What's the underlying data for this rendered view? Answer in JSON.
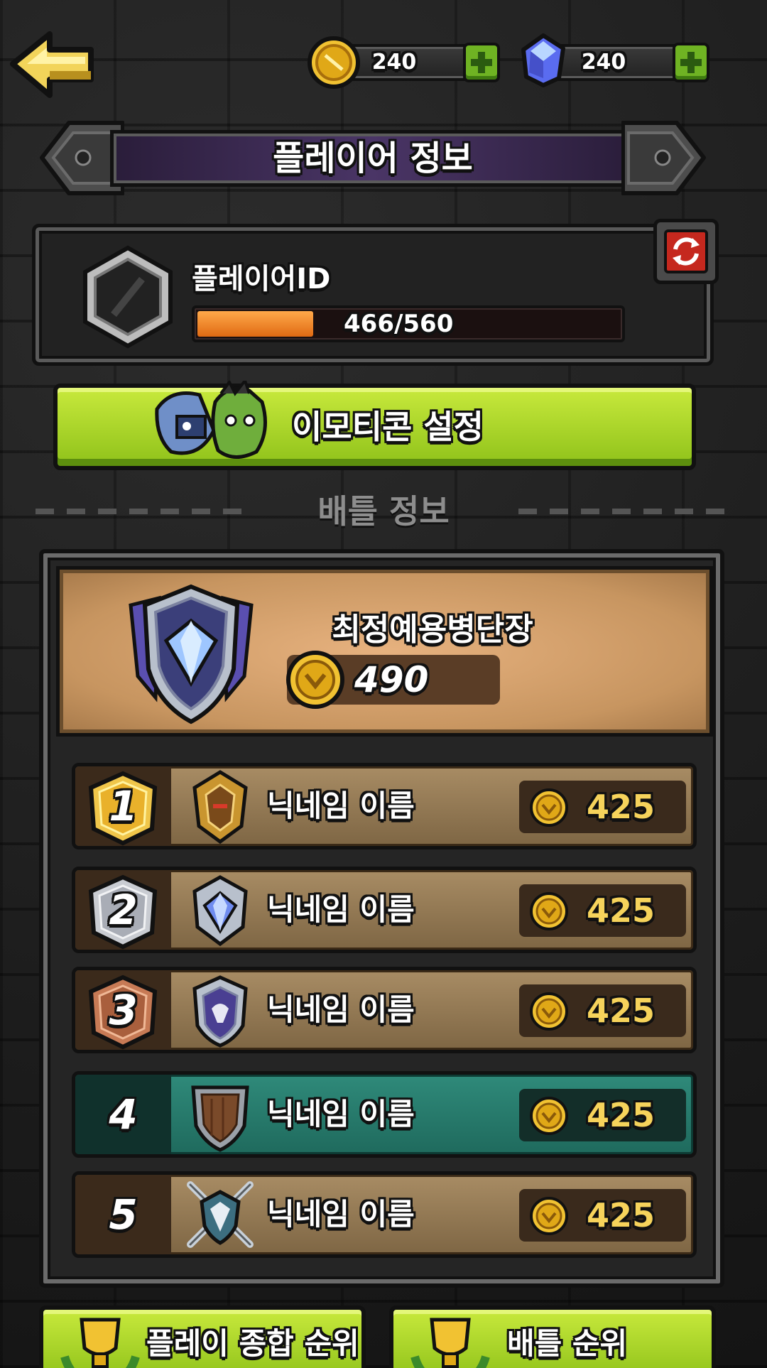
{
  "header": {
    "gold_amount": "240",
    "gem_amount": "240",
    "title": "플레이어 정보"
  },
  "player": {
    "name": "플레이어ID",
    "xp_text": "466/560",
    "xp_current": 466,
    "xp_max": 560
  },
  "emoticon_button": {
    "label": "이모티콘 설정"
  },
  "battle": {
    "section_title": "배틀 정보",
    "tier_name": "최정예용병단장",
    "tier_score": "490",
    "ranking": [
      {
        "rank": "1",
        "name": "닉네임 이름",
        "score": "425",
        "badge": "gold-rank-badge",
        "emblem": "gold-helmet-emblem"
      },
      {
        "rank": "2",
        "name": "닉네임 이름",
        "score": "425",
        "badge": "silver-rank-badge",
        "emblem": "diamond-emblem"
      },
      {
        "rank": "3",
        "name": "닉네임 이름",
        "score": "425",
        "badge": "bronze-rank-badge",
        "emblem": "eagle-shield-emblem"
      },
      {
        "rank": "4",
        "name": "닉네임 이름",
        "score": "425",
        "badge": "none",
        "emblem": "wood-shield-emblem"
      },
      {
        "rank": "5",
        "name": "닉네임 이름",
        "score": "425",
        "badge": "none",
        "emblem": "crossed-swords-emblem"
      }
    ]
  },
  "bottom_nav": {
    "overall_ranking_label": "플레이 종합 순위",
    "battle_ranking_label": "배틀 순위"
  },
  "colors": {
    "accent_green": "#9fd326",
    "highlight_row": "#2f8a7a",
    "xp_orange": "#f08a2a",
    "score_yellow": "#f6d35b"
  }
}
